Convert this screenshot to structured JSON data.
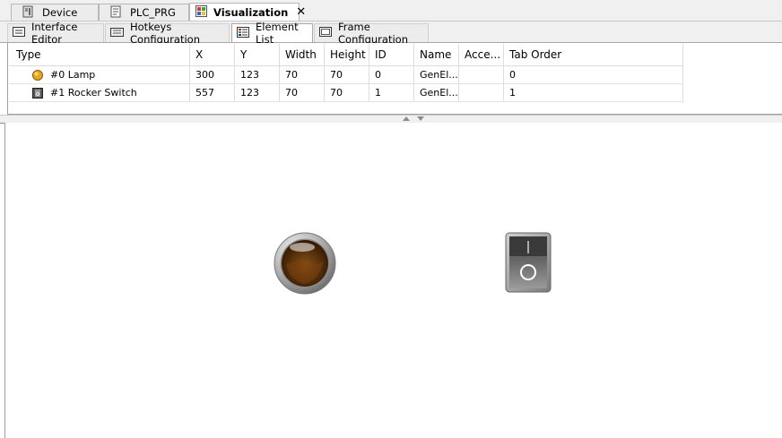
{
  "doc_tabs": [
    {
      "label": "Device",
      "icon": "device-icon"
    },
    {
      "label": "PLC_PRG",
      "icon": "program-icon"
    },
    {
      "label": "Visualization",
      "icon": "visualization-icon",
      "active": true
    }
  ],
  "sub_tabs": [
    {
      "label": "Interface Editor",
      "icon": "interface-editor-icon"
    },
    {
      "label": "Hotkeys Configuration",
      "icon": "keyboard-icon"
    },
    {
      "label": "Element List",
      "icon": "element-list-icon",
      "active": true
    },
    {
      "label": "Frame Configuration",
      "icon": "frame-config-icon"
    }
  ],
  "element_table": {
    "columns": [
      "Type",
      "X",
      "Y",
      "Width",
      "Height",
      "ID",
      "Name",
      "Acce...",
      "Tab Order"
    ],
    "rows": [
      {
        "type": "#0 Lamp",
        "icon": "lamp-icon",
        "x": "300",
        "y": "123",
        "width": "70",
        "height": "70",
        "id": "0",
        "name": "GenEl...",
        "access": "",
        "tab_order": "0"
      },
      {
        "type": "#1 Rocker Switch",
        "icon": "rocker-switch-icon",
        "x": "557",
        "y": "123",
        "width": "70",
        "height": "70",
        "id": "1",
        "name": "GenEl...",
        "access": "",
        "tab_order": "1"
      }
    ]
  },
  "canvas_elements": [
    {
      "kind": "lamp",
      "icon": "lamp-element",
      "color": "#5a3208"
    },
    {
      "kind": "rocker-switch",
      "icon": "rocker-switch-element",
      "color": "#3a3a3a"
    }
  ]
}
